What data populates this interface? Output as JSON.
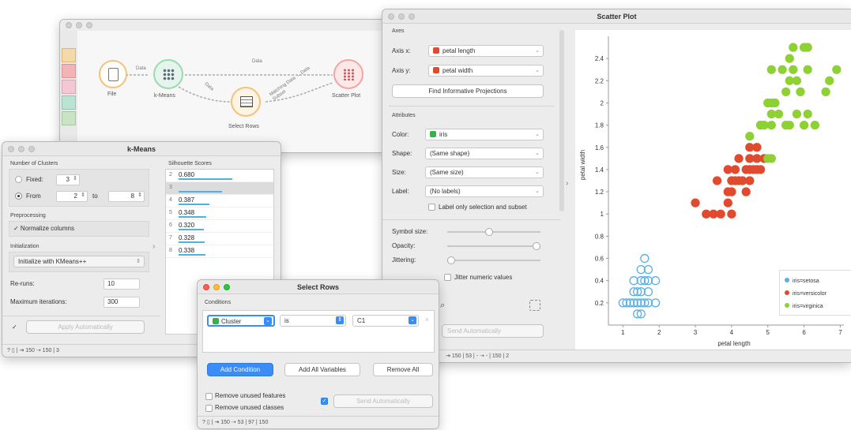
{
  "canvas": {
    "nodes": [
      {
        "label": "File"
      },
      {
        "label": "k-Means"
      },
      {
        "label": "Select Rows"
      },
      {
        "label": "Scatter Plot"
      }
    ],
    "links": [
      "Data",
      "Data",
      "Data",
      "Matching Data → Data Subset"
    ],
    "toolbar_icons": [
      "data-icon",
      "visualize-icon",
      "model-icon",
      "evaluate-icon",
      "unsupervised-icon"
    ]
  },
  "kmeans": {
    "title": "k-Means",
    "num_clusters_label": "Number of Clusters",
    "fixed_label": "Fixed:",
    "fixed_value": "3",
    "from_label": "From",
    "from_value": "2",
    "to_label": "to",
    "to_value": "8",
    "preprocessing_label": "Preprocessing",
    "normalize_label": "✓ Normalize columns",
    "initialization_label": "Initialization",
    "init_value": "Initialize with KMeans++",
    "reruns_label": "Re-runs:",
    "reruns_value": "10",
    "maxiter_label": "Maximum iterations:",
    "maxiter_value": "300",
    "apply_label": "Apply Automatically",
    "silhouette_label": "Silhouette Scores",
    "scores": [
      {
        "k": "2",
        "v": "0.680",
        "bar": 0.68
      },
      {
        "k": "3",
        "v": "",
        "bar": 0.55
      },
      {
        "k": "4",
        "v": "0.387",
        "bar": 0.387
      },
      {
        "k": "5",
        "v": "0.348",
        "bar": 0.348
      },
      {
        "k": "6",
        "v": "0.320",
        "bar": 0.32
      },
      {
        "k": "7",
        "v": "0.328",
        "bar": 0.328
      },
      {
        "k": "8",
        "v": "0.338",
        "bar": 0.338
      }
    ],
    "status": "150",
    "status2": "150 | 3"
  },
  "selectrows": {
    "title": "Select Rows",
    "conditions_label": "Conditions",
    "cond_var": "Cluster",
    "cond_op": "is",
    "cond_val": "C1",
    "add_condition": "Add Condition",
    "add_all": "Add All Variables",
    "remove_all": "Remove All",
    "remove_features": "Remove unused features",
    "remove_classes": "Remove unused classes",
    "send_auto": "Send Automatically",
    "status": "150",
    "status2": "53 | 97 | 150"
  },
  "scatter": {
    "title": "Scatter Plot",
    "axes_label": "Axes",
    "axis_x_label": "Axis x:",
    "axis_x_value": "petal length",
    "axis_y_label": "Axis y:",
    "axis_y_value": "petal width",
    "find_proj": "Find Informative Projections",
    "attributes_label": "Attributes",
    "color_label": "Color:",
    "color_value": "iris",
    "shape_label": "Shape:",
    "shape_value": "(Same shape)",
    "size_label": "Size:",
    "size_value": "(Same size)",
    "label_label": "Label:",
    "label_value": "(No labels)",
    "label_only": "Label only selection and subset",
    "symbol_size": "Symbol size:",
    "opacity": "Opacity:",
    "jittering": "Jittering:",
    "jitter_numeric": "Jitter numeric values",
    "send_auto": "Send Automatically",
    "status": "150 | 53 | -",
    "status2": "- | 150 | 2",
    "colors": {
      "setosa": "#5aaee0",
      "versicolor": "#e04a2e",
      "virginica": "#8ed133"
    }
  },
  "chart_data": {
    "type": "scatter",
    "xlabel": "petal length",
    "ylabel": "petal width",
    "xlim": [
      0.6,
      7.1
    ],
    "ylim": [
      0.0,
      2.6
    ],
    "xticks": [
      1,
      2,
      3,
      4,
      5,
      6,
      7
    ],
    "yticks": [
      0.2,
      0.4,
      0.6,
      0.8,
      1,
      1.2,
      1.4,
      1.6,
      1.8,
      2,
      2.2,
      2.4
    ],
    "legend": [
      "iris=setosa",
      "iris=versicolor",
      "iris=virginica"
    ],
    "series": [
      {
        "name": "iris=setosa",
        "color": "#5aaee0",
        "filled": false,
        "points": [
          [
            1.4,
            0.2
          ],
          [
            1.3,
            0.2
          ],
          [
            1.5,
            0.2
          ],
          [
            1.2,
            0.2
          ],
          [
            1.1,
            0.2
          ],
          [
            1.6,
            0.2
          ],
          [
            1.7,
            0.2
          ],
          [
            1.9,
            0.2
          ],
          [
            1.0,
            0.2
          ],
          [
            1.4,
            0.1
          ],
          [
            1.5,
            0.1
          ],
          [
            1.3,
            0.3
          ],
          [
            1.4,
            0.3
          ],
          [
            1.5,
            0.3
          ],
          [
            1.7,
            0.3
          ],
          [
            1.5,
            0.4
          ],
          [
            1.7,
            0.4
          ],
          [
            1.3,
            0.4
          ],
          [
            1.9,
            0.4
          ],
          [
            1.6,
            0.4
          ],
          [
            1.5,
            0.5
          ],
          [
            1.7,
            0.5
          ],
          [
            1.6,
            0.6
          ]
        ]
      },
      {
        "name": "iris=versicolor",
        "color": "#e04a2e",
        "filled": true,
        "points": [
          [
            3.0,
            1.1
          ],
          [
            3.3,
            1.0
          ],
          [
            3.5,
            1.0
          ],
          [
            3.7,
            1.0
          ],
          [
            3.9,
            1.1
          ],
          [
            3.6,
            1.3
          ],
          [
            3.9,
            1.2
          ],
          [
            4.0,
            1.2
          ],
          [
            4.1,
            1.3
          ],
          [
            4.2,
            1.3
          ],
          [
            4.4,
            1.2
          ],
          [
            4.0,
            1.3
          ],
          [
            3.9,
            1.4
          ],
          [
            4.1,
            1.4
          ],
          [
            4.4,
            1.4
          ],
          [
            4.5,
            1.4
          ],
          [
            4.7,
            1.4
          ],
          [
            4.6,
            1.4
          ],
          [
            4.2,
            1.5
          ],
          [
            4.5,
            1.5
          ],
          [
            4.7,
            1.5
          ],
          [
            4.9,
            1.5
          ],
          [
            4.5,
            1.6
          ],
          [
            4.7,
            1.6
          ],
          [
            4.8,
            1.8
          ],
          [
            4.0,
            1.0
          ],
          [
            4.5,
            1.3
          ],
          [
            4.3,
            1.3
          ],
          [
            4.8,
            1.4
          ]
        ]
      },
      {
        "name": "iris=virginica",
        "color": "#8ed133",
        "filled": true,
        "points": [
          [
            4.5,
            1.7
          ],
          [
            4.9,
            1.8
          ],
          [
            5.0,
            1.5
          ],
          [
            5.1,
            1.5
          ],
          [
            5.1,
            1.9
          ],
          [
            5.0,
            2.0
          ],
          [
            5.1,
            2.0
          ],
          [
            5.2,
            2.0
          ],
          [
            5.5,
            1.8
          ],
          [
            5.6,
            1.8
          ],
          [
            5.5,
            2.1
          ],
          [
            5.6,
            2.2
          ],
          [
            5.8,
            2.2
          ],
          [
            6.0,
            2.5
          ],
          [
            5.7,
            2.5
          ],
          [
            6.1,
            2.3
          ],
          [
            6.1,
            2.5
          ],
          [
            6.7,
            2.2
          ],
          [
            6.6,
            2.1
          ],
          [
            6.9,
            2.3
          ],
          [
            5.1,
            2.3
          ],
          [
            5.4,
            2.3
          ],
          [
            5.6,
            2.4
          ],
          [
            5.7,
            2.3
          ],
          [
            5.9,
            2.1
          ],
          [
            6.1,
            1.9
          ],
          [
            6.3,
            1.8
          ],
          [
            6.0,
            1.8
          ],
          [
            5.8,
            1.9
          ],
          [
            5.3,
            1.9
          ],
          [
            5.1,
            1.8
          ],
          [
            4.8,
            1.8
          ]
        ]
      }
    ]
  }
}
